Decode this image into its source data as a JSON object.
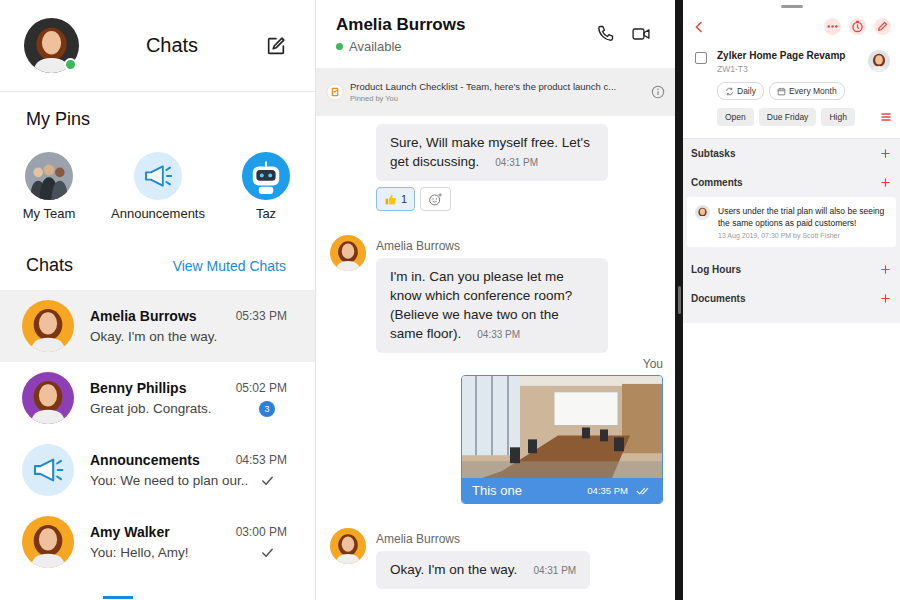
{
  "chat_list": {
    "title": "Chats",
    "user": {
      "online": true
    },
    "pins_title": "My Pins",
    "pins": [
      {
        "label": "My Team",
        "kind": "group"
      },
      {
        "label": "Announcements",
        "kind": "megaphone"
      },
      {
        "label": "Taz",
        "kind": "bot"
      }
    ],
    "chats_title": "Chats",
    "muted_link": "View Muted Chats",
    "chats": [
      {
        "name": "Amelia Burrows",
        "time": "05:33 PM",
        "preview": "Okay. I'm on the way.",
        "selected": true,
        "badge": null,
        "sent": false,
        "kind": "person",
        "color": "#f5a623"
      },
      {
        "name": "Benny Phillips",
        "time": "05:02 PM",
        "preview": "Great job. Congrats.",
        "selected": false,
        "badge": "3",
        "sent": false,
        "kind": "person",
        "color": "#8e3fb6"
      },
      {
        "name": "Announcements",
        "time": "04:53 PM",
        "preview": "You: We need to plan our..",
        "selected": false,
        "badge": null,
        "sent": true,
        "kind": "megaphone",
        "color": "#d8ecfa"
      },
      {
        "name": "Amy Walker",
        "time": "03:00 PM",
        "preview": "You: Hello, Amy!",
        "selected": false,
        "badge": null,
        "sent": true,
        "kind": "person",
        "color": "#f5a623"
      }
    ]
  },
  "conversation": {
    "contact": {
      "name": "Amelia Burrows",
      "status": "Available",
      "online": true
    },
    "pinned": {
      "text": "Product Launch Checklist - Team, here's the product launch c...",
      "note": "Pinned by You"
    },
    "messages": [
      {
        "kind": "text",
        "own": false,
        "sender": null,
        "text": "Sure, Will make myself free. Let's get discussing.",
        "time": "04:31 PM",
        "reactions": [
          {
            "count": "1",
            "selected": true
          }
        ]
      },
      {
        "kind": "text",
        "own": false,
        "sender": "Amelia Burrows",
        "text": "I'm in. Can you please let me know which conference room? (Believe we have two on the same floor).",
        "time": "04:33 PM",
        "reactions": []
      },
      {
        "kind": "image",
        "own": true,
        "sender": "You",
        "caption": "This one",
        "time": "04:35 PM",
        "read": true,
        "reactions": []
      },
      {
        "kind": "text",
        "own": false,
        "sender": "Amelia Burrows",
        "text": "Okay. I'm on the way.",
        "time": "04:31 PM",
        "reactions": []
      }
    ]
  },
  "task": {
    "title": "Zylker Home Page Revamp",
    "id": "ZW1-T3",
    "done": false,
    "recurrence": [
      {
        "label": "Daily",
        "kind": "repeat"
      },
      {
        "label": "Every Month",
        "kind": "calendar"
      }
    ],
    "attributes": [
      "Open",
      "Due Friday",
      "High"
    ],
    "sections": [
      {
        "label": "Subtasks",
        "comments": []
      },
      {
        "label": "Comments",
        "comments": [
          {
            "text": "Users under the trial plan will also be seeing the same options as paid customers!",
            "meta": "13 Aug 2019, 07:30 PM by Scott Fisher"
          }
        ]
      },
      {
        "label": "Log Hours",
        "comments": []
      },
      {
        "label": "Documents",
        "comments": []
      }
    ]
  }
}
